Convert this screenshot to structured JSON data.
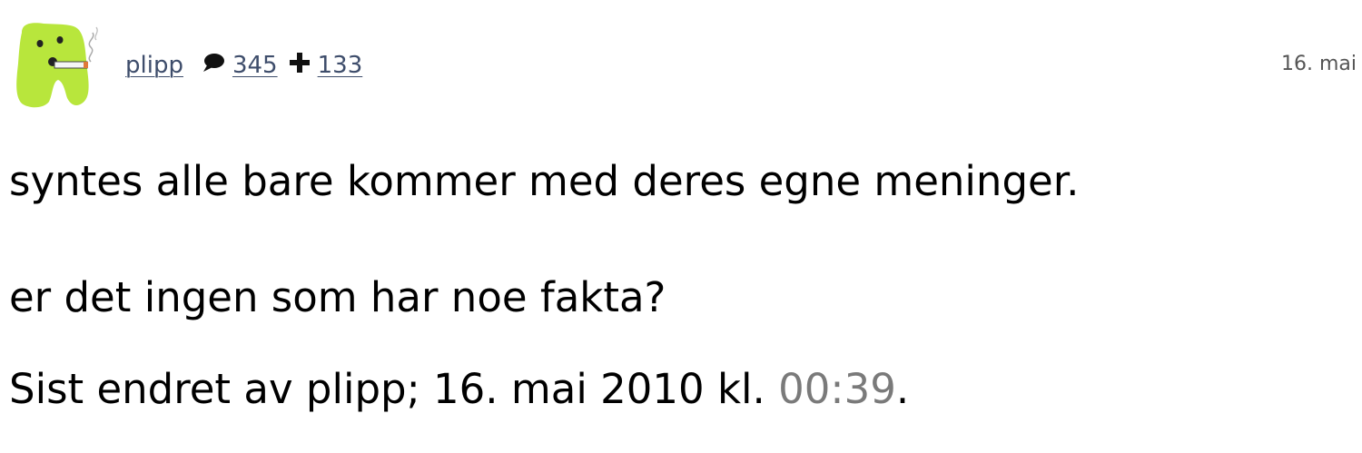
{
  "post": {
    "author": {
      "username": "plipp",
      "posts_count": "345",
      "likes_count": "133"
    },
    "date_short": "16. mai",
    "body_lines": [
      "syntes alle bare kommer med deres egne meninger.",
      "er det ingen som har noe fakta?"
    ],
    "edited": {
      "prefix": "Sist endret av plipp; 16. mai 2010 kl. ",
      "time": "00:39",
      "suffix": "."
    }
  },
  "colors": {
    "avatar_green": "#b8e63c",
    "link": "#3e4d6b"
  },
  "icons": {
    "posts": "speech-bubble-icon",
    "likes": "plus-icon"
  }
}
